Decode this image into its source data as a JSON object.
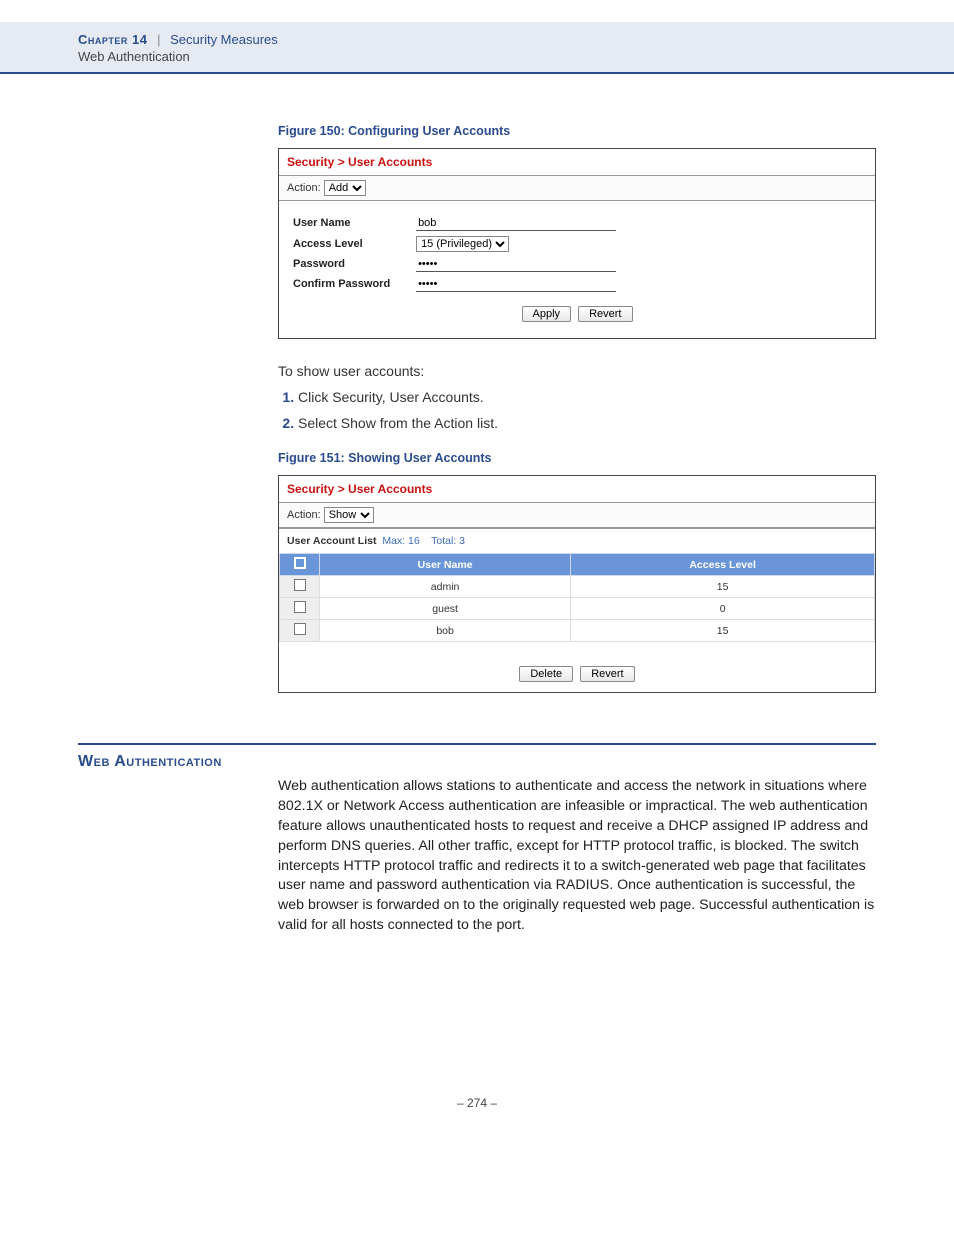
{
  "header": {
    "chapter": "Chapter 14",
    "title": "Security Measures",
    "subtitle": "Web Authentication"
  },
  "fig150": {
    "caption": "Figure 150:  Configuring User Accounts",
    "breadcrumb": "Security > User Accounts",
    "action_label": "Action:",
    "action_value": "Add",
    "fields": {
      "user_name_label": "User Name",
      "user_name_value": "bob",
      "access_level_label": "Access Level",
      "access_level_value": "15 (Privileged)",
      "password_label": "Password",
      "password_value": "•••••",
      "confirm_label": "Confirm Password",
      "confirm_value": "•••••"
    },
    "apply": "Apply",
    "revert": "Revert"
  },
  "intro_text": "To show user accounts:",
  "steps": {
    "s1": "Click Security, User Accounts.",
    "s2": "Select Show from the Action list."
  },
  "fig151": {
    "caption": "Figure 151:  Showing User Accounts",
    "breadcrumb": "Security > User Accounts",
    "action_label": "Action:",
    "action_value": "Show",
    "list_label": "User Account List",
    "max_label": "Max: 16",
    "total_label": "Total: 3",
    "col_user": "User Name",
    "col_level": "Access Level",
    "rows": [
      {
        "user": "admin",
        "level": "15"
      },
      {
        "user": "guest",
        "level": "0"
      },
      {
        "user": "bob",
        "level": "15"
      }
    ],
    "delete": "Delete",
    "revert": "Revert"
  },
  "section": {
    "heading": "Web Authentication",
    "body": "Web authentication allows stations to authenticate and access the network in situations where 802.1X or Network Access authentication are infeasible or impractical. The web authentication feature allows unauthenticated hosts to request and receive a DHCP assigned IP address and perform DNS queries. All other traffic, except for HTTP protocol traffic, is blocked. The switch intercepts HTTP protocol traffic and redirects it to a switch-generated web page that facilitates user name and password authentication via RADIUS. Once authentication is successful, the web browser is forwarded on to the originally requested web page. Successful authentication is valid for all hosts connected to the port."
  },
  "page_number": "–  274  –"
}
